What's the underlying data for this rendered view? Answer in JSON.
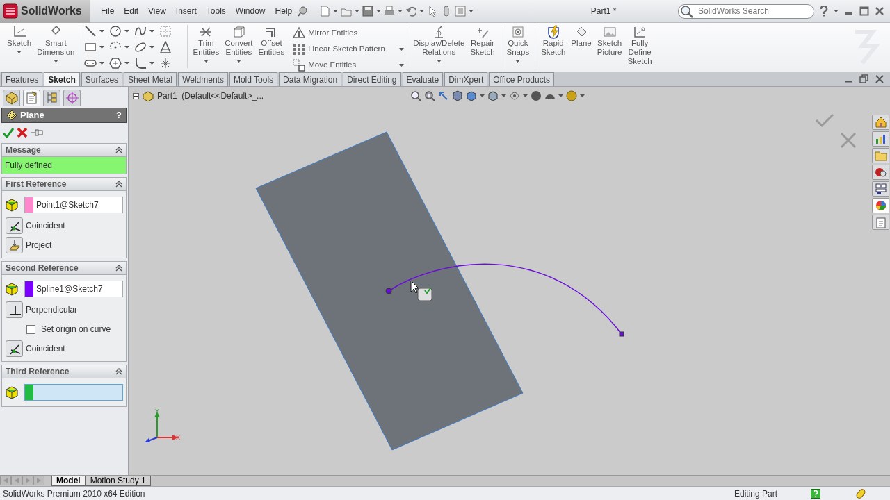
{
  "app": {
    "logo": "SolidWorks",
    "document_title": "Part1 *"
  },
  "menu": [
    "File",
    "Edit",
    "View",
    "Insert",
    "Tools",
    "Window",
    "Help"
  ],
  "search": {
    "placeholder": "SolidWorks Search"
  },
  "ribbon": [
    {
      "kind": "large",
      "label": "Sketch",
      "dropdown": true
    },
    {
      "kind": "large",
      "label": "Smart Dimension",
      "dropdown": true
    },
    {
      "kind": "separator"
    },
    {
      "kind": "tools"
    },
    {
      "kind": "separator"
    },
    {
      "kind": "large",
      "label": "Trim Entities",
      "dropdown": true
    },
    {
      "kind": "large",
      "label": "Convert Entities",
      "dropdown": true
    },
    {
      "kind": "large",
      "label": "Offset Entities",
      "dropdown": false
    },
    {
      "kind": "list",
      "items": [
        {
          "label": "Mirror Entities",
          "dropdown": false
        },
        {
          "label": "Linear Sketch Pattern",
          "dropdown": true
        },
        {
          "label": "Move Entities",
          "dropdown": true
        }
      ]
    },
    {
      "kind": "separator"
    },
    {
      "kind": "large",
      "label": "Display/Delete Relations",
      "dropdown": true
    },
    {
      "kind": "large",
      "label": "Repair Sketch",
      "dropdown": false
    },
    {
      "kind": "separator"
    },
    {
      "kind": "large",
      "label": "Quick Snaps",
      "dropdown": true
    },
    {
      "kind": "separator"
    },
    {
      "kind": "large",
      "label": "Rapid Sketch",
      "dropdown": false
    },
    {
      "kind": "large",
      "label": "Plane",
      "dropdown": false
    },
    {
      "kind": "large",
      "label": "Sketch Picture",
      "dropdown": false
    },
    {
      "kind": "large",
      "label": "Fully Define Sketch",
      "dropdown": false
    }
  ],
  "tabs": [
    {
      "label": "Features",
      "selected": false
    },
    {
      "label": "Sketch",
      "selected": true
    },
    {
      "label": "Surfaces",
      "selected": false
    },
    {
      "label": "Sheet Metal",
      "selected": false
    },
    {
      "label": "Weldments",
      "selected": false
    },
    {
      "label": "Mold Tools",
      "selected": false
    },
    {
      "label": "Data Migration",
      "selected": false
    },
    {
      "label": "Direct Editing",
      "selected": false
    },
    {
      "label": "Evaluate",
      "selected": false
    },
    {
      "label": "DimXpert",
      "selected": false
    },
    {
      "label": "Office Products",
      "selected": false
    }
  ],
  "panel_tabs": [
    {
      "kind": "feature_tree",
      "selected": false
    },
    {
      "kind": "property_manager",
      "selected": true
    },
    {
      "kind": "configuration",
      "selected": false
    },
    {
      "kind": "dimxpert",
      "selected": false
    }
  ],
  "property_manager": {
    "title": "Plane",
    "help": "?",
    "sections": [
      {
        "kind": "message",
        "title": "Message",
        "message": "Fully defined"
      },
      {
        "kind": "reference",
        "title": "First Reference",
        "field": {
          "value": "Point1@Sketch7",
          "color": "#ff88cc",
          "active": false
        },
        "options": [
          {
            "kind": "coincident",
            "label": "Coincident"
          },
          {
            "kind": "project",
            "label": "Project"
          }
        ]
      },
      {
        "kind": "reference",
        "title": "Second Reference",
        "field": {
          "value": "Spline1@Sketch7",
          "color": "#7a00ff",
          "active": false
        },
        "options": [
          {
            "kind": "perpendicular",
            "label": "Perpendicular"
          },
          {
            "kind": "checkbox",
            "label": "Set origin on curve",
            "checked": false
          },
          {
            "kind": "coincident",
            "label": "Coincident"
          }
        ]
      },
      {
        "kind": "reference",
        "title": "Third Reference",
        "field": {
          "color": "#22bb44",
          "active": true
        }
      }
    ]
  },
  "viewport": {
    "tree_label": "Part1  (Default<<Default>_...",
    "triad": {
      "x_label": "X",
      "y_label": "Y"
    }
  },
  "task_pane": [
    {
      "kind": "home",
      "selected": false
    },
    {
      "kind": "library",
      "selected": false
    },
    {
      "kind": "folder",
      "selected": false
    },
    {
      "kind": "explorer",
      "selected": false
    },
    {
      "kind": "palette",
      "selected": false
    },
    {
      "kind": "appearances",
      "selected": true
    },
    {
      "kind": "properties",
      "selected": false
    }
  ],
  "model_tabs": [
    {
      "label": "Model",
      "selected": true
    },
    {
      "label": "Motion Study 1",
      "selected": false
    }
  ],
  "status_bar": {
    "edition": "SolidWorks Premium 2010 x64 Edition",
    "mode": "Editing Part"
  }
}
